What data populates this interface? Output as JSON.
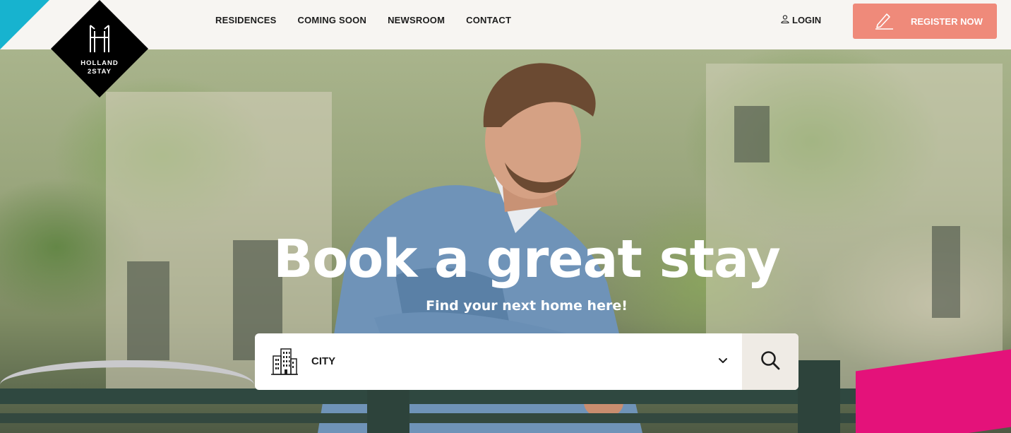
{
  "brand": {
    "logo_line1": "HOLLAND",
    "logo_line2": "2STAY",
    "accent_teal": "#17b3cf",
    "accent_coral": "#ef8a7a"
  },
  "nav": {
    "items": [
      {
        "label": "RESIDENCES"
      },
      {
        "label": "COMING SOON"
      },
      {
        "label": "NEWSROOM"
      },
      {
        "label": "CONTACT"
      }
    ]
  },
  "header": {
    "login_label": "LOGIN",
    "register_label": "REGISTER NOW"
  },
  "hero": {
    "title": "Book a great stay",
    "subtitle": "Find your next home here!"
  },
  "search": {
    "city_label": "CITY",
    "city_icon": "building-icon",
    "search_icon": "search-icon"
  }
}
